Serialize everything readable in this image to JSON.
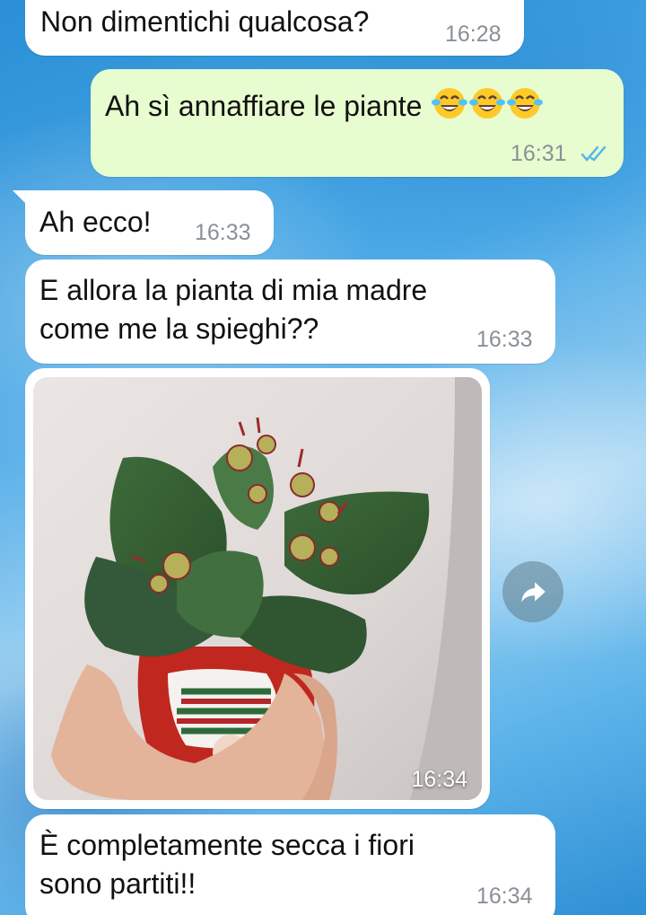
{
  "messages": [
    {
      "type": "incoming",
      "lines": [
        "Non dimentichi qualcosa?"
      ],
      "time": "16:28"
    },
    {
      "type": "outgoing",
      "lines": [
        "Ah sì annaffiare le piante"
      ],
      "emoji": "face-with-tears-of-joy x3",
      "time": "16:31",
      "status": "read"
    },
    {
      "type": "incoming",
      "lines": [
        "Ah ecco!"
      ],
      "time": "16:33"
    },
    {
      "type": "incoming",
      "lines": [
        "E allora la pianta di mia madre",
        "come me la spieghi??"
      ],
      "time": "16:33"
    },
    {
      "type": "incoming-image",
      "time": "16:34"
    },
    {
      "type": "incoming",
      "lines": [
        "È completamente secca i fiori",
        "sono partiti!!"
      ],
      "time": "16:34"
    }
  ],
  "icons": {
    "read_receipt": "double-check-icon",
    "forward": "forward-arrow-icon"
  },
  "colors": {
    "incoming_bubble": "#ffffff",
    "outgoing_bubble": "#e7fccf",
    "read_check": "#4fb6ec",
    "timestamp": "#8a9097"
  }
}
